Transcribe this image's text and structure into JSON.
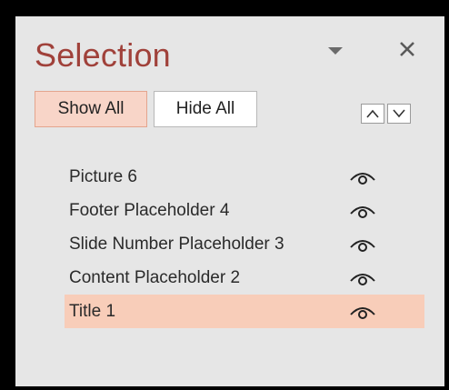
{
  "panel": {
    "title": "Selection",
    "dropdown_icon": "chevron-down-icon",
    "close_icon": "close-icon"
  },
  "toolbar": {
    "show_all_label": "Show All",
    "hide_all_label": "Hide All",
    "bring_forward_icon": "chevron-up-icon",
    "send_backward_icon": "chevron-down-icon"
  },
  "objects": [
    {
      "label": "Picture 6",
      "visible": true,
      "selected": false
    },
    {
      "label": "Footer Placeholder 4",
      "visible": true,
      "selected": false
    },
    {
      "label": "Slide Number Placeholder 3",
      "visible": true,
      "selected": false
    },
    {
      "label": "Content Placeholder 2",
      "visible": true,
      "selected": false
    },
    {
      "label": "Title 1",
      "visible": true,
      "selected": true
    }
  ],
  "colors": {
    "title": "#a0413a",
    "selected_row": "#f8cdb9",
    "active_button": "#f8d5c8",
    "panel_bg": "#e6e6e6"
  }
}
